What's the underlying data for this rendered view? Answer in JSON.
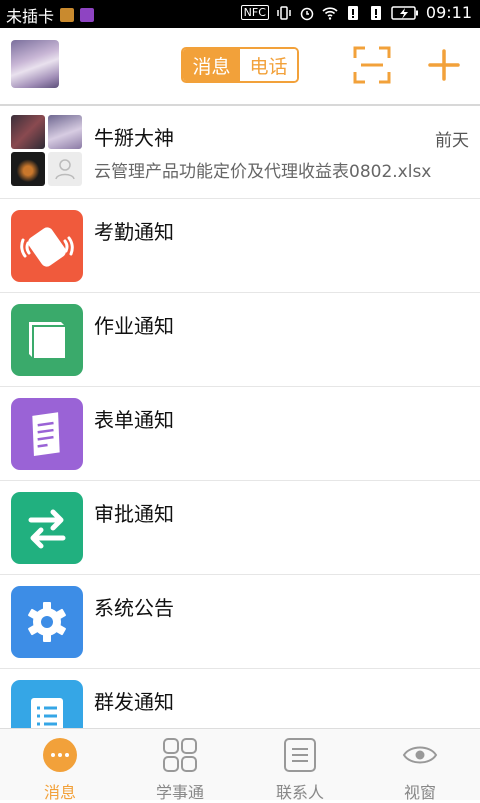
{
  "status_bar": {
    "carrier": "未插卡",
    "nfc": "NFC",
    "time": "09:11"
  },
  "header": {
    "segment": {
      "messages_label": "消息",
      "calls_label": "电话"
    }
  },
  "chat": {
    "name": "牛掰大神",
    "time": "前天",
    "last_message": "云管理产品功能定价及代理收益表0802.xlsx"
  },
  "notices": [
    {
      "title": "考勤通知",
      "color": "#f05a3c",
      "icon": "attendance-vibrate-icon"
    },
    {
      "title": "作业通知",
      "color": "#3aaa6b",
      "icon": "book-icon"
    },
    {
      "title": "表单通知",
      "color": "#9a63d6",
      "icon": "form-icon"
    },
    {
      "title": "审批通知",
      "color": "#21b07f",
      "icon": "swap-arrows-icon"
    },
    {
      "title": "系统公告",
      "color": "#3d8de6",
      "icon": "gear-icon"
    },
    {
      "title": "群发通知",
      "color": "#35a6e6",
      "icon": "list-icon"
    }
  ],
  "tabbar": {
    "accent": "#f2a13a",
    "tabs": [
      {
        "label": "消息",
        "icon": "chat-bubble-icon",
        "active": true
      },
      {
        "label": "学事通",
        "icon": "grid-icon",
        "active": false
      },
      {
        "label": "联系人",
        "icon": "contacts-icon",
        "active": false
      },
      {
        "label": "视窗",
        "icon": "eye-icon",
        "active": false
      }
    ]
  }
}
